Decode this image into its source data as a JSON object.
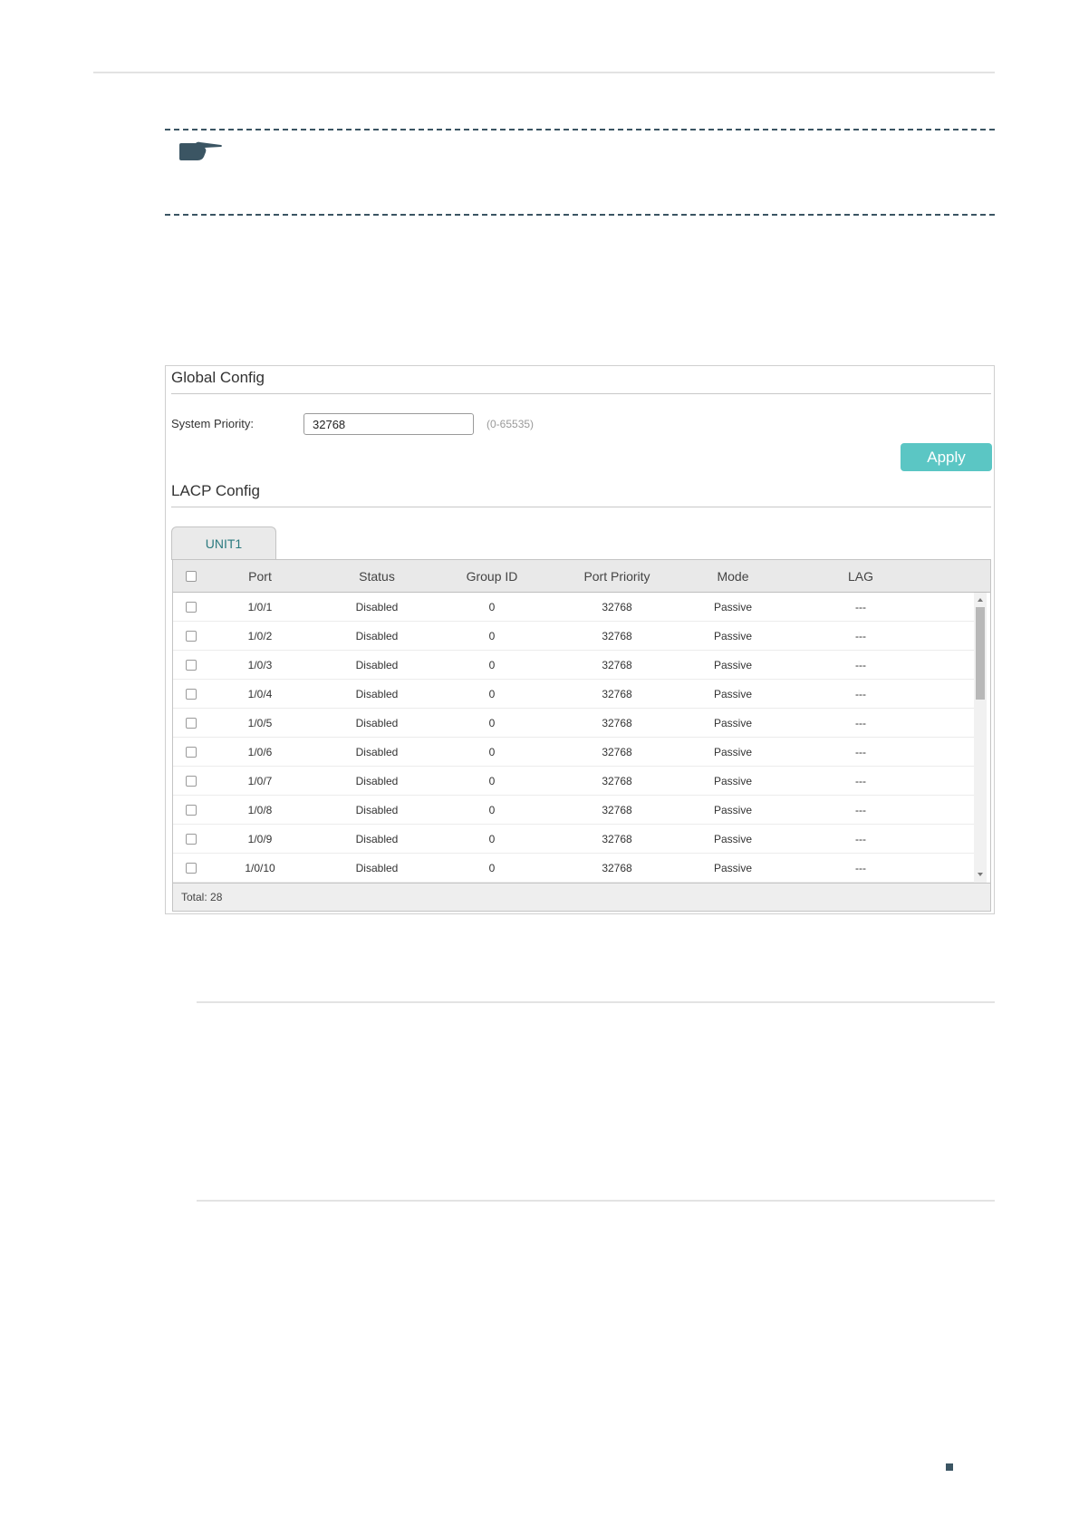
{
  "global_config": {
    "title": "Global Config",
    "system_priority_label": "System Priority:",
    "system_priority_value": "32768",
    "system_priority_range": "(0-65535)",
    "apply_label": "Apply"
  },
  "lacp_config": {
    "title": "LACP Config",
    "tab_label": "UNIT1",
    "columns": [
      "Port",
      "Status",
      "Group ID",
      "Port Priority",
      "Mode",
      "LAG"
    ],
    "rows": [
      {
        "port": "1/0/1",
        "status": "Disabled",
        "group_id": "0",
        "port_priority": "32768",
        "mode": "Passive",
        "lag": "---"
      },
      {
        "port": "1/0/2",
        "status": "Disabled",
        "group_id": "0",
        "port_priority": "32768",
        "mode": "Passive",
        "lag": "---"
      },
      {
        "port": "1/0/3",
        "status": "Disabled",
        "group_id": "0",
        "port_priority": "32768",
        "mode": "Passive",
        "lag": "---"
      },
      {
        "port": "1/0/4",
        "status": "Disabled",
        "group_id": "0",
        "port_priority": "32768",
        "mode": "Passive",
        "lag": "---"
      },
      {
        "port": "1/0/5",
        "status": "Disabled",
        "group_id": "0",
        "port_priority": "32768",
        "mode": "Passive",
        "lag": "---"
      },
      {
        "port": "1/0/6",
        "status": "Disabled",
        "group_id": "0",
        "port_priority": "32768",
        "mode": "Passive",
        "lag": "---"
      },
      {
        "port": "1/0/7",
        "status": "Disabled",
        "group_id": "0",
        "port_priority": "32768",
        "mode": "Passive",
        "lag": "---"
      },
      {
        "port": "1/0/8",
        "status": "Disabled",
        "group_id": "0",
        "port_priority": "32768",
        "mode": "Passive",
        "lag": "---"
      },
      {
        "port": "1/0/9",
        "status": "Disabled",
        "group_id": "0",
        "port_priority": "32768",
        "mode": "Passive",
        "lag": "---"
      },
      {
        "port": "1/0/10",
        "status": "Disabled",
        "group_id": "0",
        "port_priority": "32768",
        "mode": "Passive",
        "lag": "---"
      }
    ],
    "total_label": "Total: 28"
  },
  "colors": {
    "accent": "#5bc6c4",
    "tab_text": "#2b7a7f",
    "note_icon": "#3b5563"
  },
  "icons": {
    "note": "pointing-hand-icon"
  }
}
